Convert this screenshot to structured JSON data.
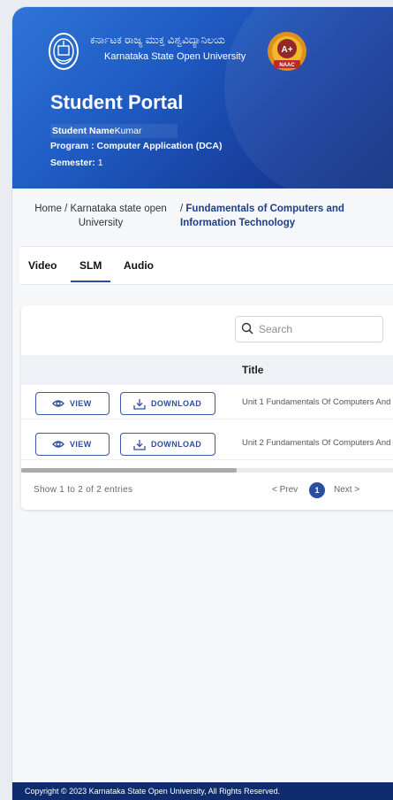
{
  "university": {
    "name_kannada": "ಕರ್ನಾಟಕ ರಾಜ್ಯ ಮುಕ್ತ ವಿಶ್ವವಿದ್ಯಾನಿಲಯ",
    "name_english": "Karnataka State Open University",
    "naac_grade": "A+",
    "naac_label": "NAAC"
  },
  "header": {
    "title": "Student Portal",
    "student_name_label": "Student Name",
    "student_name_value": "Kumar",
    "program_label": "Program : ",
    "program_value": "Computer Application (DCA)",
    "semester_label": "Semester:",
    "semester_value": "1"
  },
  "breadcrumb": {
    "part1": "Home / Karnataka state open University",
    "separator": "/",
    "current": "Fundamentals of Computers and Information Technology"
  },
  "tabs": [
    {
      "label": "Video",
      "active": false
    },
    {
      "label": "SLM",
      "active": true
    },
    {
      "label": "Audio",
      "active": false
    }
  ],
  "table": {
    "search_placeholder": "Search",
    "column_title": "Title",
    "rows": [
      {
        "view_label": "VIEW",
        "download_label": "DOWNLOAD",
        "title": "Unit 1 Fundamentals Of Computers And"
      },
      {
        "view_label": "VIEW",
        "download_label": "DOWNLOAD",
        "title": "Unit 2 Fundamentals Of Computers And"
      }
    ],
    "entries_text": "Show 1  to 2  of 2 entries",
    "prev_label": "< Prev",
    "current_page": "1",
    "next_label": "Next  >"
  },
  "footer": {
    "text": "Copyright © 2023 Karnataka State Open University, All Rights Reserved."
  },
  "colors": {
    "header_start": "#2f74d6",
    "header_end": "#10307f",
    "accent": "#2b4ea0",
    "footer": "#0f2d6e"
  }
}
